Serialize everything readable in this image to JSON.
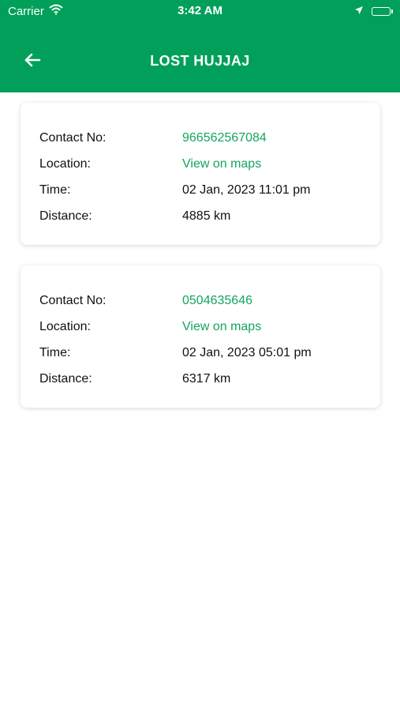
{
  "status_bar": {
    "carrier": "Carrier",
    "time": "3:42 AM",
    "icons": [
      "wifi-icon",
      "location-arrow-icon",
      "battery-icon"
    ]
  },
  "header": {
    "title": "LOST HUJJAJ",
    "back_icon": "back-arrow-icon",
    "background_color": "#00a05a"
  },
  "cards": [
    {
      "contact_label": "Contact No:",
      "contact_value": "966562567084",
      "location_label": "Location:",
      "location_value": "View on maps",
      "time_label": "Time:",
      "time_value": "02 Jan, 2023 11:01 pm",
      "distance_label": "Distance:",
      "distance_value": "4885 km"
    },
    {
      "contact_label": "Contact No:",
      "contact_value": "0504635646",
      "location_label": "Location:",
      "location_value": "View on maps",
      "time_label": "Time:",
      "time_value": "02 Jan, 2023 05:01 pm",
      "distance_label": "Distance:",
      "distance_value": "6317 km"
    }
  ],
  "colors": {
    "brand_green": "#00a05a",
    "link_green": "#13a55f",
    "text": "#111111",
    "card_background": "#ffffff"
  }
}
